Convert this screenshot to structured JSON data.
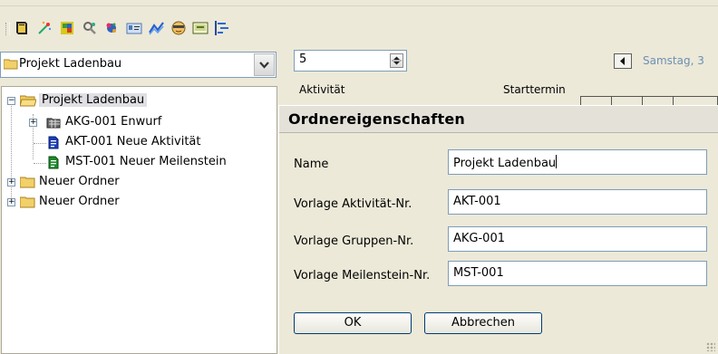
{
  "toolbar": {
    "icons": [
      "book-icon",
      "wand-icon",
      "puzzle-icon",
      "tools-icon",
      "sparkle-icon",
      "card-icon",
      "wave-chart-icon",
      "face-icon",
      "display-icon",
      "gantt-icon"
    ]
  },
  "project_select": {
    "value": "Projekt Ladenbau"
  },
  "tree": {
    "root": "Projekt Ladenbau",
    "children": [
      "AKG-001 Enwurf",
      "AKT-001 Neue Aktivität",
      "MST-001 Neuer Meilenstein"
    ],
    "folders": [
      "Neuer Ordner",
      "Neuer Ordner"
    ]
  },
  "spinner": {
    "value": "5"
  },
  "date_nav": {
    "text": "Samstag, 3"
  },
  "columns": {
    "activity": "Aktivität",
    "start": "Starttermin"
  },
  "dialog": {
    "title": "Ordnereigenschaften",
    "fields": [
      {
        "label": "Name",
        "value": "Projekt Ladenbau"
      },
      {
        "label": "Vorlage Aktivität-Nr.",
        "value": "AKT-001"
      },
      {
        "label": "Vorlage Gruppen-Nr.",
        "value": "AKG-001"
      },
      {
        "label": "Vorlage Meilenstein-Nr.",
        "value": "MST-001"
      }
    ],
    "ok_label": "OK",
    "cancel_label": "Abbrechen"
  }
}
